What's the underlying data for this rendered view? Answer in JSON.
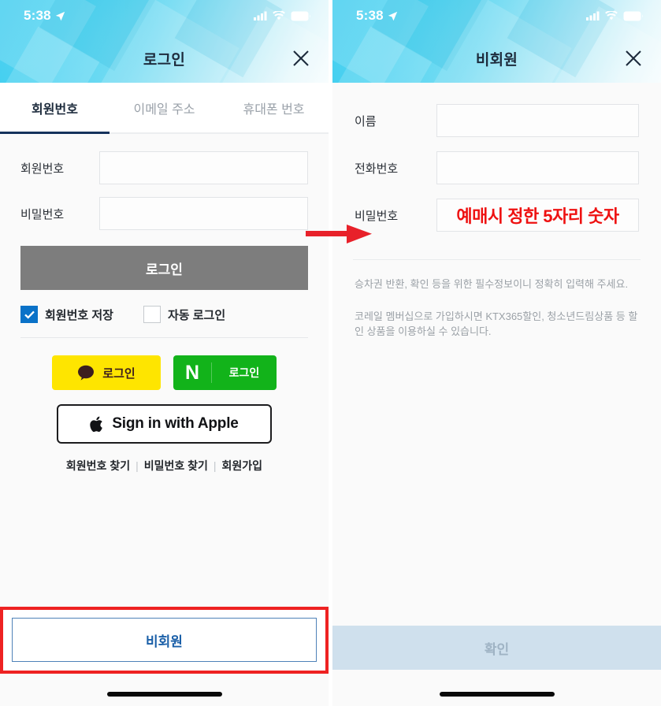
{
  "status_bar": {
    "time": "5:38",
    "location_icon": "location-arrow-icon",
    "signal_icon": "cellular-signal-icon",
    "wifi_icon": "wifi-icon",
    "battery_icon": "battery-full-icon"
  },
  "colors": {
    "hero_cyan": "#2ec8ee",
    "tab_active": "#14325c",
    "login_button": "#7d7d7d",
    "checkbox_on": "#0a72c8",
    "kakao_yellow": "#FEE500",
    "naver_green": "#12b31a",
    "annotation_red": "#ee1111",
    "highlight_red": "#ee2222",
    "cta_blue": "#1a5fa8",
    "confirm_disabled": "#cfe0ed"
  },
  "left_screen": {
    "title": "로그인",
    "close_label": "✕",
    "tabs": [
      {
        "label": "회원번호",
        "active": true
      },
      {
        "label": "이메일 주소",
        "active": false
      },
      {
        "label": "휴대폰 번호",
        "active": false
      }
    ],
    "fields": [
      {
        "label": "회원번호",
        "value": "",
        "placeholder": ""
      },
      {
        "label": "비밀번호",
        "value": "",
        "placeholder": ""
      }
    ],
    "login_button": "로그인",
    "checkboxes": [
      {
        "label": "회원번호 저장",
        "checked": true
      },
      {
        "label": "자동 로그인",
        "checked": false
      }
    ],
    "social": {
      "kakao_label": "로그인",
      "kakao_icon": "kakao-speech-bubble-icon",
      "naver_mark": "N",
      "naver_label": "로그인",
      "apple_label": "Sign in with Apple",
      "apple_icon": "apple-logo-icon"
    },
    "links": [
      {
        "label": "회원번호 찾기"
      },
      {
        "label": "비밀번호 찾기"
      },
      {
        "label": "회원가입"
      }
    ],
    "link_separator": "|",
    "cta_button": "비회원"
  },
  "right_screen": {
    "title": "비회원",
    "close_label": "✕",
    "fields": [
      {
        "label": "이름",
        "value": "",
        "placeholder": ""
      },
      {
        "label": "전화번호",
        "value": "",
        "placeholder": ""
      },
      {
        "label": "비밀번호",
        "value": "",
        "placeholder": ""
      }
    ],
    "password_annotation": "예매시 정한 5자리 숫자",
    "notes": [
      "승차권 반환, 확인 등을 위한 필수정보이니 정확히 입력해 주세요.",
      "코레일 멤버십으로 가입하시면 KTX365할인, 청소년드림상품 등 할인 상품을 이용하실 수 있습니다."
    ],
    "confirm_button": "확인"
  },
  "annotation": {
    "arrow_icon": "red-right-arrow-icon"
  }
}
